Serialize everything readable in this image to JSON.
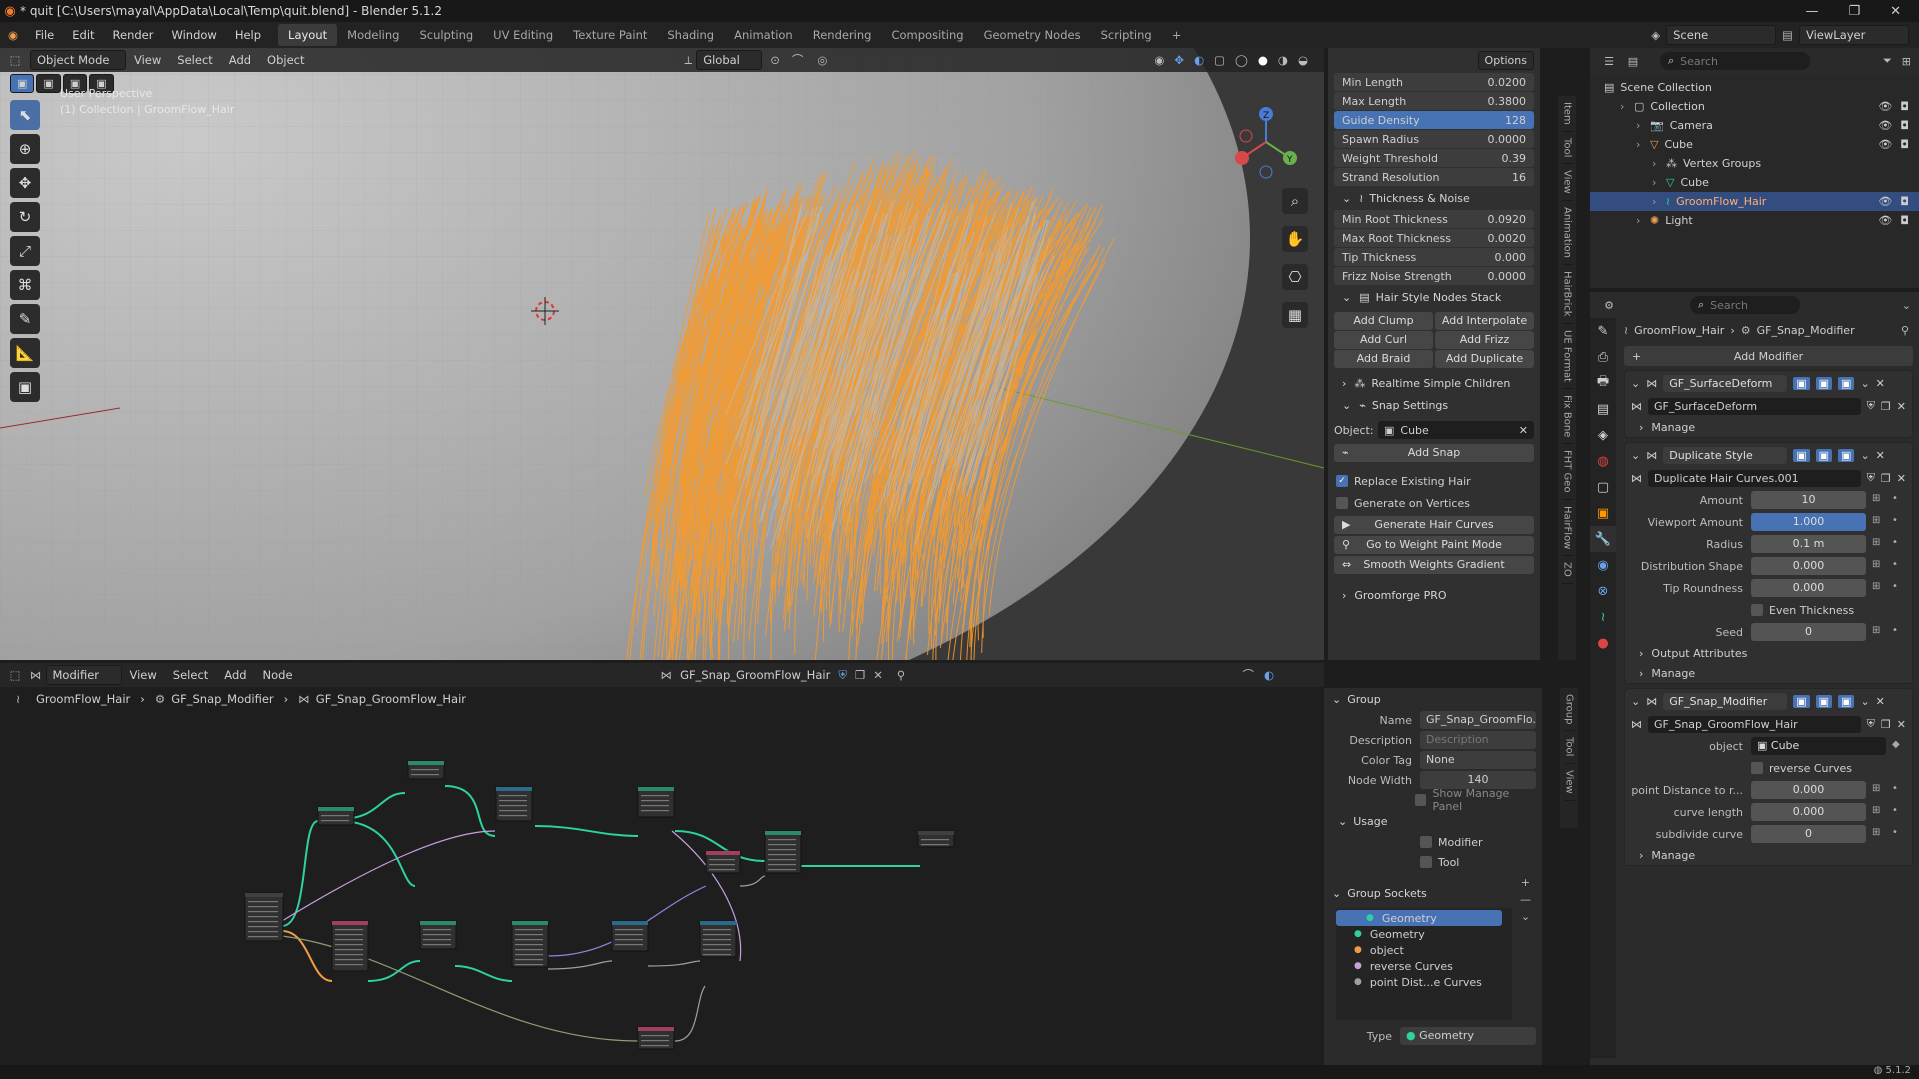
{
  "window": {
    "title": "* quit [C:\\Users\\mayal\\AppData\\Local\\Temp\\quit.blend] - Blender 5.1.2"
  },
  "menu": {
    "items": [
      "File",
      "Edit",
      "Render",
      "Window",
      "Help"
    ],
    "workspaces": [
      "Layout",
      "Modeling",
      "Sculpting",
      "UV Editing",
      "Texture Paint",
      "Shading",
      "Animation",
      "Rendering",
      "Compositing",
      "Geometry Nodes",
      "Scripting"
    ],
    "active_workspace": "Layout",
    "add_workspace": "+"
  },
  "topright": {
    "scene": "Scene",
    "view_layer": "ViewLayer"
  },
  "viewport": {
    "mode": "Object Mode",
    "menus": [
      "View",
      "Select",
      "Add",
      "Object"
    ],
    "orientation": "Global",
    "options_label": "Options",
    "overlay_line1": "User Perspective",
    "overlay_line2": "(1) Collection | GroomFlow_Hair",
    "gizmo_axes": [
      "Z",
      "Y",
      "X"
    ],
    "hair_color": "#f59a2c"
  },
  "npanel": {
    "fields_top": [
      {
        "label": "Min Length",
        "value": "0.0200"
      },
      {
        "label": "Max Length",
        "value": "0.3800"
      },
      {
        "label": "Guide Density",
        "value": "128"
      },
      {
        "label": "Spawn Radius",
        "value": "0.0000"
      },
      {
        "label": "Weight Threshold",
        "value": "0.39"
      },
      {
        "label": "Strand Resolution",
        "value": "16"
      }
    ],
    "thickness_section": "Thickness & Noise",
    "thickness_fields": [
      {
        "label": "Min Root Thickness",
        "value": "0.0920"
      },
      {
        "label": "Max Root Thickness",
        "value": "0.0020"
      },
      {
        "label": "Tip Thickness",
        "value": "0.000"
      },
      {
        "label": "Frizz Noise Strength",
        "value": "0.0000"
      }
    ],
    "stack_section": "Hair Style Nodes Stack",
    "stack_buttons": [
      [
        "Add Clump",
        "Add Interpolate"
      ],
      [
        "Add Curl",
        "Add Frizz"
      ],
      [
        "Add Braid",
        "Add Duplicate"
      ]
    ],
    "realtime_section": "Realtime Simple Children",
    "snap_section": "Snap Settings",
    "object_label": "Object:",
    "object_value": "Cube",
    "add_snap": "Add Snap",
    "replace_existing": "Replace Existing Hair",
    "generate_on_vertices": "Generate on Vertices",
    "generate_button": "Generate Hair Curves",
    "weight_paint_button": "Go to Weight Paint Mode",
    "smooth_button": "Smooth Weights Gradient",
    "groomforge": "Groomforge PRO",
    "vtabs": [
      "Item",
      "Tool",
      "View",
      "Animation",
      "HairBrick",
      "UE Format",
      "Fix Bone",
      "FHT Geo",
      "HairFlow",
      "ZO"
    ]
  },
  "nodeeditor": {
    "editor_type": "Modifier",
    "menus": [
      "View",
      "Select",
      "Add",
      "Node"
    ],
    "nodegroup": "GF_Snap_GroomFlow_Hair",
    "breadcrumb": [
      "GroomFlow_Hair",
      "GF_Snap_Modifier",
      "GF_Snap_GroomFlow_Hair"
    ],
    "panel": {
      "group_section": "Group",
      "name_label": "Name",
      "name_value": "GF_Snap_GroomFlo...",
      "desc_label": "Description",
      "desc_placeholder": "Description",
      "color_tag_label": "Color Tag",
      "color_tag_value": "None",
      "node_width_label": "Node Width",
      "node_width_value": "140",
      "show_manage": "Show Manage Panel",
      "usage_section": "Usage",
      "usage_modifier": "Modifier",
      "usage_tool": "Tool",
      "sockets_section": "Group Sockets",
      "sockets": [
        {
          "name": "Geometry",
          "color": "#2ed1a0",
          "selected": true
        },
        {
          "name": "Geometry",
          "color": "#2ed1a0"
        },
        {
          "name": "object",
          "color": "#f29b46"
        },
        {
          "name": "reverse Curves",
          "color": "#c7a0e0"
        },
        {
          "name": "point Dist...e Curves",
          "color": "#a0a0a0"
        }
      ],
      "type_label": "Type",
      "type_value": "Geometry"
    },
    "side_tabs": [
      "Group",
      "Tool",
      "View"
    ]
  },
  "outliner": {
    "search_placeholder": "Search",
    "rows": [
      {
        "label": "Scene Collection",
        "indent": 0,
        "icon": "scene-collection-icon"
      },
      {
        "label": "Collection",
        "indent": 1,
        "icon": "collection-icon"
      },
      {
        "label": "Camera",
        "indent": 2,
        "icon": "camera-icon"
      },
      {
        "label": "Cube",
        "indent": 2,
        "icon": "mesh-icon"
      },
      {
        "label": "Vertex Groups",
        "indent": 3,
        "icon": "vertex-groups-icon"
      },
      {
        "label": "Cube",
        "indent": 3,
        "icon": "mesh-data-icon"
      },
      {
        "label": "GroomFlow_Hair",
        "indent": 3,
        "icon": "curves-icon",
        "selected": true
      },
      {
        "label": "Light",
        "indent": 2,
        "icon": "light-icon"
      }
    ]
  },
  "properties": {
    "search_placeholder": "Search",
    "breadcrumb_object": "GroomFlow_Hair",
    "breadcrumb_modifier": "GF_Snap_Modifier",
    "add_modifier": "Add Modifier",
    "modifiers": [
      {
        "name": "GF_SurfaceDeform",
        "group": "GF_SurfaceDeform",
        "manage": "Manage",
        "rows": []
      },
      {
        "name": "Duplicate Style",
        "group": "Duplicate Hair Curves.001",
        "rows": [
          {
            "label": "Amount",
            "value": "10"
          },
          {
            "label": "Viewport Amount",
            "value": "1.000",
            "blue": true
          },
          {
            "label": "Radius",
            "value": "0.1 m"
          },
          {
            "label": "Distribution Shape",
            "value": "0.000"
          },
          {
            "label": "Tip Roundness",
            "value": "0.000"
          },
          {
            "label": "",
            "value": "Even Thickness",
            "checkbox": true
          },
          {
            "label": "Seed",
            "value": "0"
          }
        ],
        "extra": [
          "Output Attributes",
          "Manage"
        ]
      },
      {
        "name": "GF_Snap_Modifier",
        "group": "GF_Snap_GroomFlow_Hair",
        "rows": [
          {
            "label": "object",
            "value": "Cube",
            "object": true
          },
          {
            "label": "",
            "value": "reverse Curves",
            "checkbox": true
          },
          {
            "label": "point Distance to r...",
            "value": "0.000"
          },
          {
            "label": "curve length",
            "value": "0.000"
          },
          {
            "label": "subdivide curve",
            "value": "0"
          }
        ],
        "extra": [
          "Manage"
        ]
      }
    ]
  },
  "statusbar": {
    "version": "5.1.2"
  }
}
